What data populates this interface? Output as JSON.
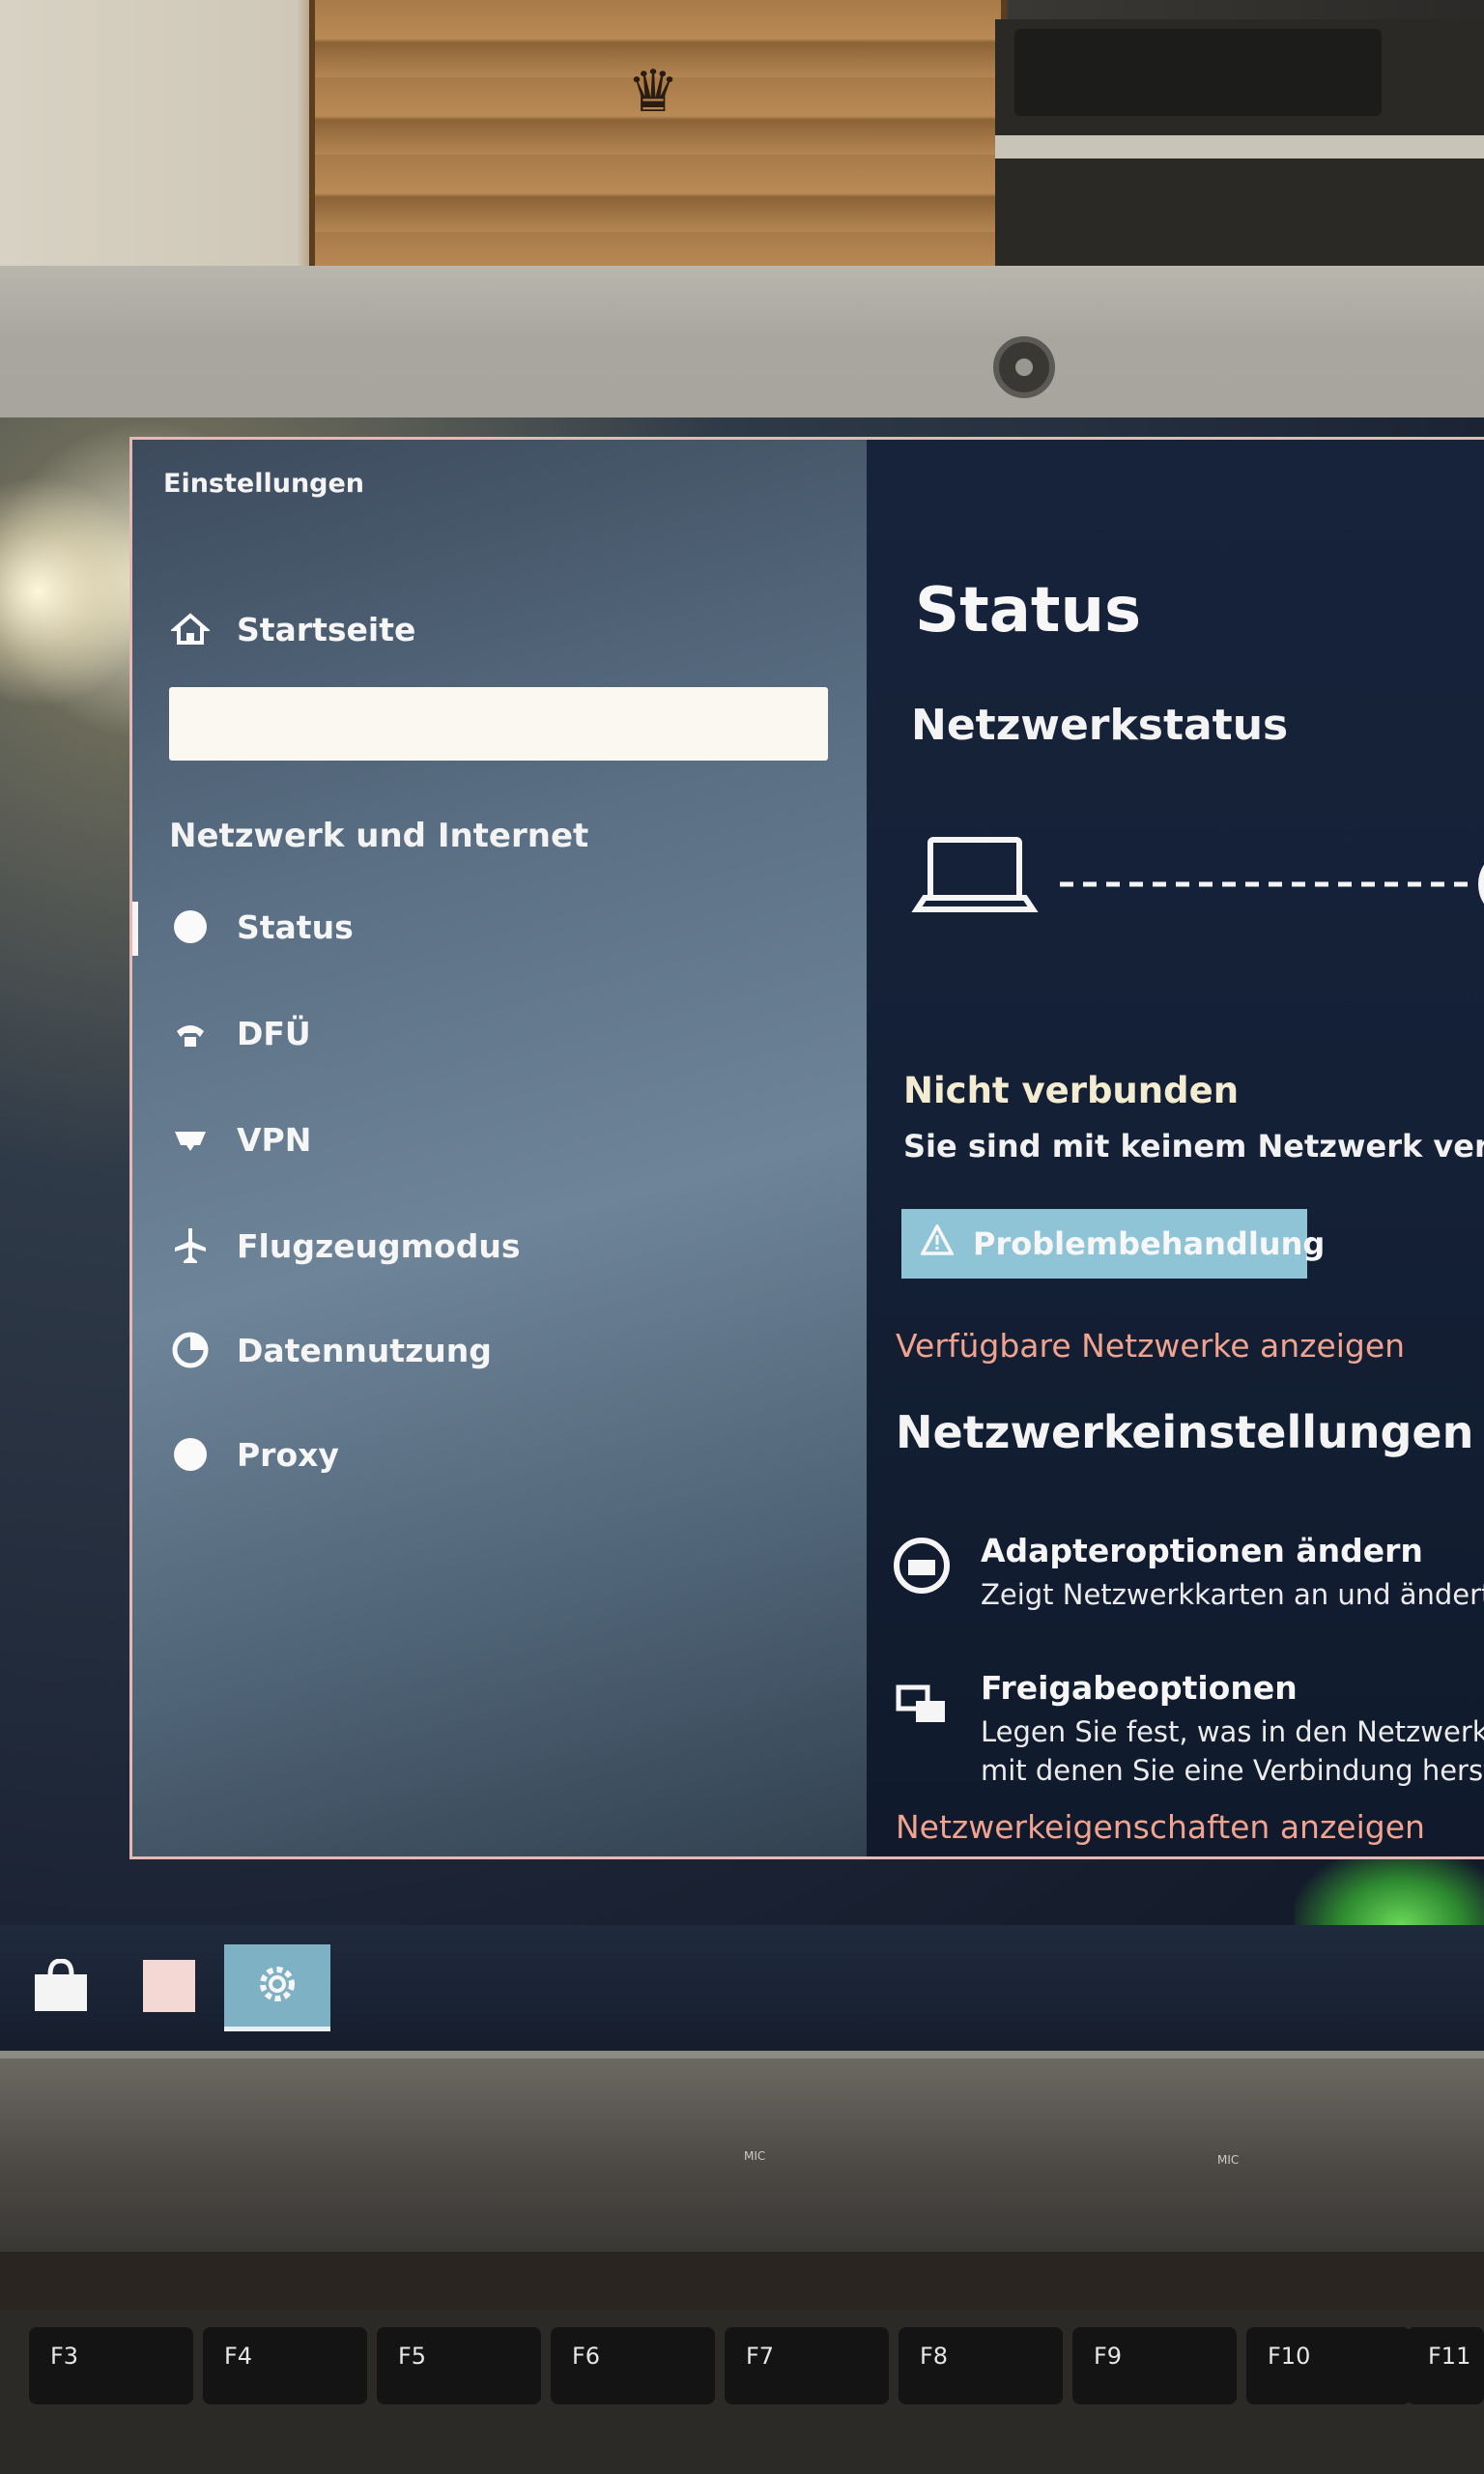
{
  "window": {
    "title": "Einstellungen"
  },
  "sidebar": {
    "home_label": "Startseite",
    "search": {
      "value": "",
      "placeholder": ""
    },
    "section": "Netzwerk und Internet",
    "items": [
      {
        "label": "Status",
        "icon": "globe-icon",
        "selected": true
      },
      {
        "label": "DFÜ",
        "icon": "dialup-phone-icon"
      },
      {
        "label": "VPN",
        "icon": "vpn-icon"
      },
      {
        "label": "Flugzeugmodus",
        "icon": "airplane-icon"
      },
      {
        "label": "Datennutzung",
        "icon": "data-usage-icon"
      },
      {
        "label": "Proxy",
        "icon": "globe-icon"
      }
    ]
  },
  "main": {
    "title": "Status",
    "subtitle": "Netzwerkstatus",
    "status_heading": "Nicht verbunden",
    "status_text": "Sie sind mit keinem Netzwerk verbunde",
    "troubleshoot_label": "Problembehandlung",
    "show_networks_link": "Verfügbare Netzwerke anzeigen",
    "change_settings_heading": "Netzwerkeinstellungen ändern",
    "options": [
      {
        "title": "Adapteroptionen ändern",
        "desc": [
          "Zeigt Netzwerkkarten an und ändert Verb"
        ]
      },
      {
        "title": "Freigabeoptionen",
        "desc": [
          "Legen Sie fest, was in den Netzwerken frei",
          "mit denen Sie eine Verbindung herstellen."
        ]
      }
    ],
    "properties_link": "Netzwerkeigenschaften anzeigen"
  },
  "taskbar": {
    "buttons": [
      {
        "icon": "store-bag-icon"
      },
      {
        "icon": "app-tile-icon"
      },
      {
        "icon": "settings-gear-icon",
        "active": true
      }
    ]
  },
  "keyboard": {
    "keys": [
      "F3",
      "F4",
      "F5",
      "F6",
      "F7",
      "F8",
      "F9",
      "F10",
      "F11"
    ],
    "mic_label": "MIC"
  },
  "colors": {
    "accent": "#8fc4d6",
    "link": "#f0a38f",
    "sidebar": "#5a6f84",
    "content_bg": "#17233a"
  }
}
